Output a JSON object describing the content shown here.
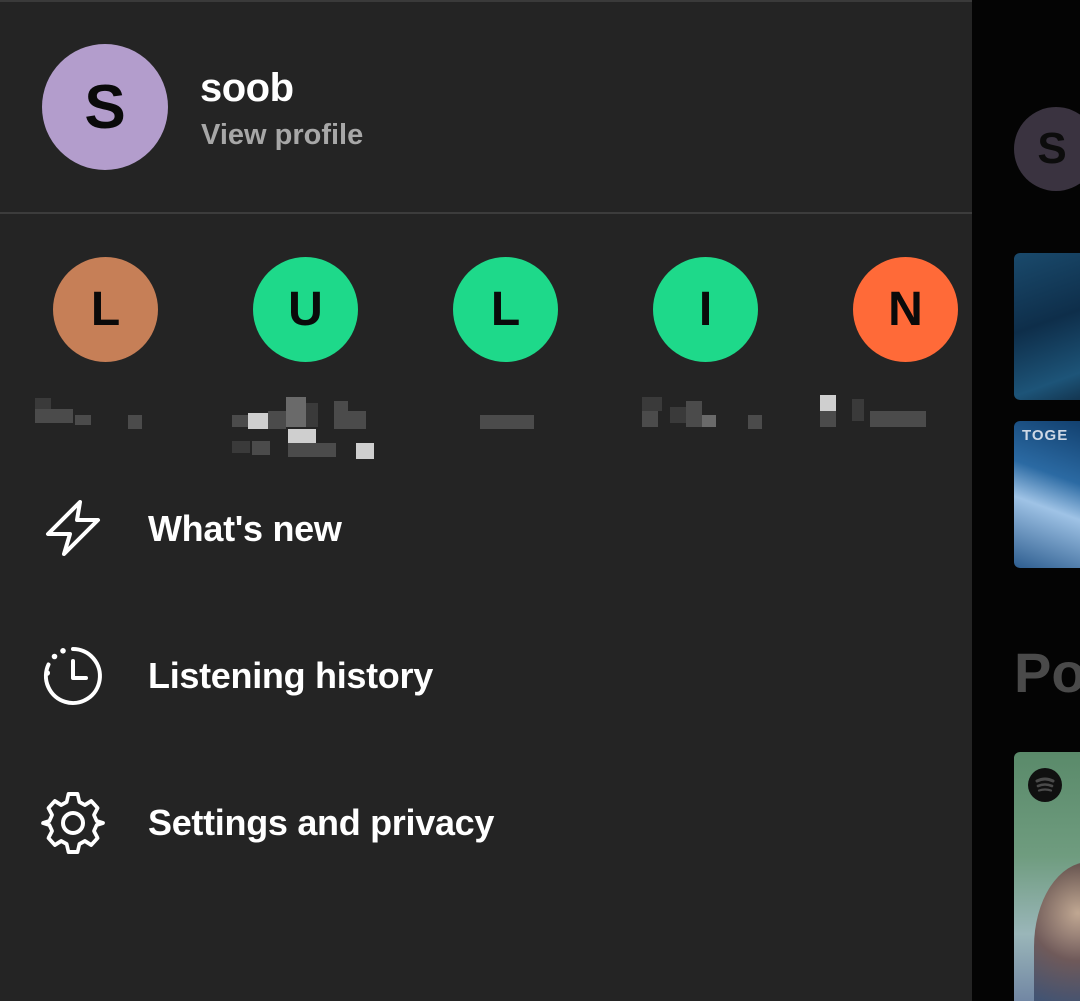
{
  "profile": {
    "initial": "S",
    "name": "soob",
    "link": "View profile",
    "avatar_color": "#b39dcc"
  },
  "accounts": [
    {
      "initial": "L",
      "color": "#c67f57"
    },
    {
      "initial": "U",
      "color": "#1ed98a"
    },
    {
      "initial": "L",
      "color": "#1ed98a"
    },
    {
      "initial": "I",
      "color": "#1ed98a"
    },
    {
      "initial": "N",
      "color": "#ff6a38"
    }
  ],
  "menu": {
    "whats_new": {
      "label": "What's new",
      "icon": "lightning-icon"
    },
    "listening_history": {
      "label": "Listening history",
      "icon": "clock-history-icon"
    },
    "settings": {
      "label": "Settings and privacy",
      "icon": "gear-icon"
    }
  },
  "background": {
    "avatar_initial": "S",
    "card_text": "TOGE",
    "heading": "Po"
  },
  "colors": {
    "drawer_bg": "#242424",
    "text_primary": "#ffffff",
    "text_secondary": "#a7a7a7",
    "accent_green": "#1ed98a"
  }
}
